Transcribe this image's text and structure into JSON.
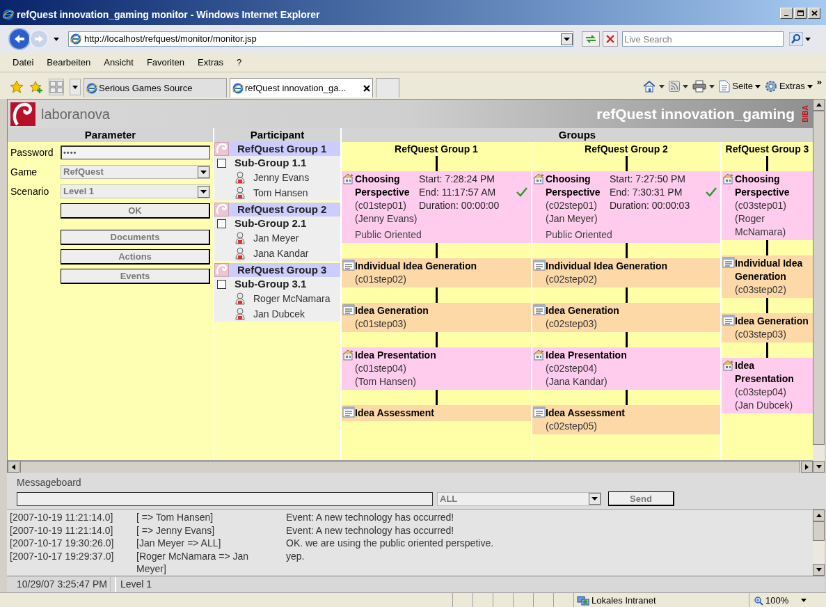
{
  "window": {
    "title": "refQuest innovation_gaming monitor - Windows Internet Explorer"
  },
  "address_bar": {
    "url": "http://localhost/refquest/monitor/monitor.jsp",
    "search_placeholder": "Live Search"
  },
  "menu": [
    "Datei",
    "Bearbeiten",
    "Ansicht",
    "Favoriten",
    "Extras",
    "?"
  ],
  "tabs": [
    {
      "label": "Serious Games Source",
      "selected": false
    },
    {
      "label": "refQuest innovation_ga...",
      "selected": true
    }
  ],
  "command_bar": {
    "items": [
      "Seite",
      "Extras"
    ],
    "more": "»"
  },
  "banner": {
    "brand": "laboranova",
    "title": "refQuest innovation_gaming",
    "side_mark": "BIBA"
  },
  "parameter": {
    "heading": "Parameter",
    "fields": [
      {
        "kind": "password",
        "label": "Password",
        "value": "••••"
      },
      {
        "kind": "select",
        "label": "Game",
        "value": "RefQuest"
      },
      {
        "kind": "select",
        "label": "Scenario",
        "value": "Level 1"
      }
    ],
    "buttons": [
      "OK",
      "Documents",
      "Actions",
      "Events"
    ]
  },
  "participant": {
    "heading": "Participant",
    "groups": [
      {
        "name": "RefQuest Group 1",
        "children": [
          {
            "name": "Sub-Group 1.1",
            "checked": false,
            "children": [
              {
                "name": "Jenny Evans"
              },
              {
                "name": "Tom Hansen"
              }
            ]
          }
        ]
      },
      {
        "name": "RefQuest Group 2",
        "children": [
          {
            "name": "Sub-Group 2.1",
            "checked": false,
            "children": [
              {
                "name": "Jan Meyer"
              },
              {
                "name": "Jana Kandar"
              }
            ]
          }
        ]
      },
      {
        "name": "RefQuest Group 3",
        "children": [
          {
            "name": "Sub-Group 3.1",
            "checked": false,
            "children": [
              {
                "name": "Roger McNamara"
              },
              {
                "name": "Jan Dubcek"
              }
            ]
          }
        ]
      }
    ]
  },
  "groups": {
    "heading": "Groups",
    "columns": [
      {
        "name": "RefQuest Group 1",
        "steps": [
          {
            "kind": "assigned",
            "title": "Choosing Perspective",
            "code": "(c01step01)",
            "person": "(Jenny Evans)",
            "start": "Start: 7:28:24 PM",
            "end": "End: 11:17:57 AM",
            "duration": "Duration: 00:00:00",
            "done": true,
            "result": "Public Oriented"
          },
          {
            "kind": "plain",
            "title": "Individual Idea Generation",
            "code": "(c01step02)"
          },
          {
            "kind": "plain",
            "title": "Idea Generation",
            "code": "(c01step03)"
          },
          {
            "kind": "assigned",
            "title": "Idea Presentation",
            "code": "(c01step04)",
            "person": "(Tom Hansen)"
          },
          {
            "kind": "plain",
            "title": "Idea Assessment"
          }
        ]
      },
      {
        "name": "RefQuest Group 2",
        "steps": [
          {
            "kind": "assigned",
            "title": "Choosing Perspective",
            "code": "(c02step01)",
            "person": "(Jan Meyer)",
            "start": "Start: 7:27:50 PM",
            "end": "End: 7:30:31 PM",
            "duration": "Duration: 00:00:03",
            "done": true,
            "result": "Public Oriented"
          },
          {
            "kind": "plain",
            "title": "Individual Idea Generation",
            "code": "(c02step02)"
          },
          {
            "kind": "plain",
            "title": "Idea Generation",
            "code": "(c02step03)"
          },
          {
            "kind": "assigned",
            "title": "Idea Presentation",
            "code": "(c02step04)",
            "person": "(Jana Kandar)"
          },
          {
            "kind": "plain",
            "title": "Idea Assessment",
            "code": "(c02step05)"
          }
        ]
      },
      {
        "name": "RefQuest Group 3",
        "steps": [
          {
            "kind": "assigned",
            "title": "Choosing Perspective",
            "code": "(c03step01)",
            "person": "(Roger McNamara)"
          },
          {
            "kind": "plain",
            "title": "Individual Idea Generation",
            "code": "(c03step02)"
          },
          {
            "kind": "plain",
            "title": "Idea Generation",
            "code": "(c03step03)"
          },
          {
            "kind": "assigned",
            "title": "Idea Presentation",
            "code": "(c03step04)",
            "person": "(Jan Dubcek)"
          }
        ]
      }
    ]
  },
  "messageboard": {
    "label": "Messageboard",
    "recipient": "ALL",
    "send": "Send",
    "log": [
      {
        "time": "[2007-10-19 11:21:14.0]",
        "route": "[ => Tom Hansen]",
        "text": "Event: A new technology has occurred!"
      },
      {
        "time": "[2007-10-19 11:21:14.0]",
        "route": "[ => Jenny Evans]",
        "text": "Event: A new technology has occurred!"
      },
      {
        "time": "[2007-10-17 19:30:26.0]",
        "route": "[Jan Meyer => ALL]",
        "text": "OK. we are using the public oriented perspetive."
      },
      {
        "time": "[2007-10-17 19:29:37.0]",
        "route": "[Roger McNamara => Jan Meyer]",
        "text": "yep."
      }
    ]
  },
  "status_line": [
    "10/29/07 3:25:47 PM",
    "Level 1"
  ],
  "status_bar": {
    "zone": "Lokales Intranet",
    "zoom": "100%"
  }
}
